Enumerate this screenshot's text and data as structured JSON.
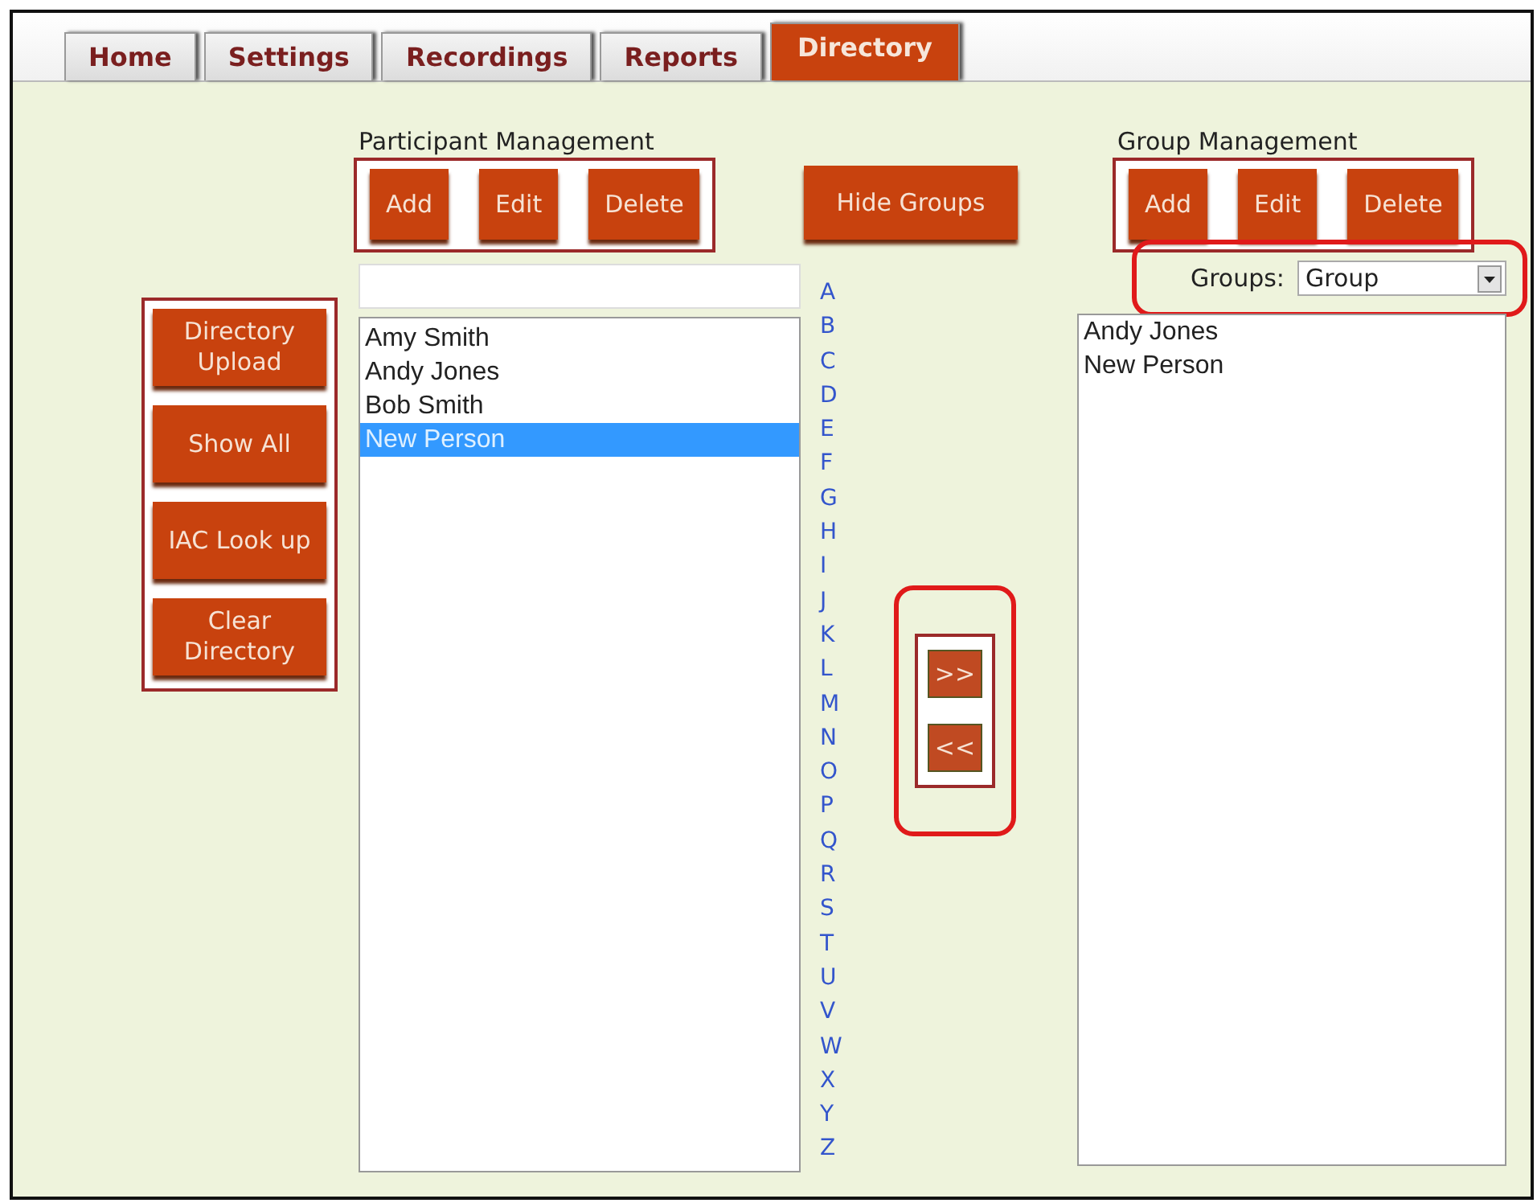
{
  "tabs": [
    {
      "label": "Home",
      "selected": false
    },
    {
      "label": "Settings",
      "selected": false
    },
    {
      "label": "Recordings",
      "selected": false
    },
    {
      "label": "Reports",
      "selected": false
    },
    {
      "label": "Directory",
      "selected": true
    }
  ],
  "directory_buttons": [
    {
      "label": "Directory Upload"
    },
    {
      "label": "Show All"
    },
    {
      "label": "IAC Look up"
    },
    {
      "label": "Clear Directory"
    }
  ],
  "participant_management": {
    "title": "Participant Management",
    "buttons": [
      "Add",
      "Edit",
      "Delete"
    ],
    "participants": [
      {
        "name": "Amy Smith",
        "selected": false
      },
      {
        "name": "Andy Jones",
        "selected": false
      },
      {
        "name": "Bob Smith",
        "selected": false
      },
      {
        "name": "New Person",
        "selected": true
      }
    ]
  },
  "letters": [
    "A",
    "B",
    "C",
    "D",
    "E",
    "F",
    "G",
    "H",
    "I",
    "J",
    "K",
    "L",
    "M",
    "N",
    "O",
    "P",
    "Q",
    "R",
    "S",
    "T",
    "U",
    "V",
    "W",
    "X",
    "Y",
    "Z"
  ],
  "hide_groups_button": "Hide Groups",
  "transfer_buttons": [
    ">>",
    "<<"
  ],
  "group_management": {
    "title": "Group Management",
    "buttons": [
      "Add",
      "Edit",
      "Delete"
    ],
    "groups_label": "Groups:",
    "groups_value": "Group",
    "members": [
      {
        "name": "Andy Jones"
      },
      {
        "name": "New Person"
      }
    ]
  }
}
